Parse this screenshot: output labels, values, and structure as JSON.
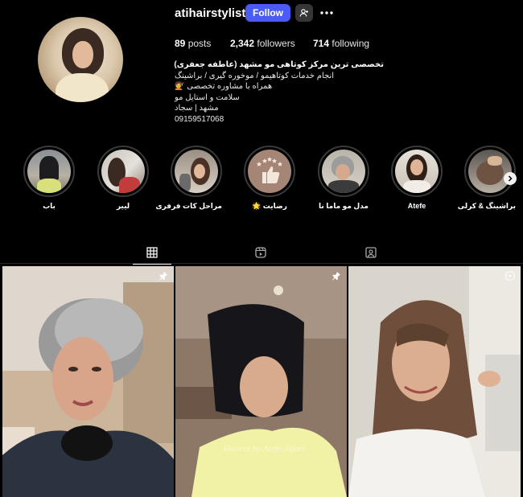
{
  "profile": {
    "username": "atihairstylist",
    "follow_label": "Follow",
    "stats": {
      "posts_count": "89",
      "posts_label": "posts",
      "followers_count": "2,342",
      "followers_label": "followers",
      "following_count": "714",
      "following_label": "following"
    },
    "bio": {
      "name": "تخصصی ترین مرکز کوتاهی مو مشهد (عاطفه جعفری)",
      "lines": [
        "انجام خدمات کوتاهیمو / موخوره گیری / براشینگ",
        "همراه با مشاوره تخصصی 💇",
        "سلامت و استایل مو",
        "مشهد | سجاد",
        "09159517068"
      ]
    }
  },
  "highlights": [
    {
      "label": "باب"
    },
    {
      "label": "لییر"
    },
    {
      "label": "مراحل کات فرفری"
    },
    {
      "label": "رضایت 🌟"
    },
    {
      "label": "مدل مو ماما نا"
    },
    {
      "label": "Atefe"
    },
    {
      "label": "براشینگ & کرلی"
    }
  ],
  "tabs": [
    {
      "name": "posts",
      "icon": "grid-icon",
      "active": true
    },
    {
      "name": "reels",
      "icon": "reels-icon",
      "active": false
    },
    {
      "name": "tagged",
      "icon": "tagged-icon",
      "active": false
    }
  ],
  "posts": [
    {
      "pinned": true,
      "type": "image"
    },
    {
      "pinned": true,
      "type": "image",
      "watermark": "Haircut by Atefe Jafari"
    },
    {
      "pinned": false,
      "type": "reel"
    }
  ],
  "colors": {
    "background": "#000000",
    "follow_button": "#4a5cf5",
    "secondary_button": "#363636",
    "highlight_ring": "#3a3a3a"
  }
}
